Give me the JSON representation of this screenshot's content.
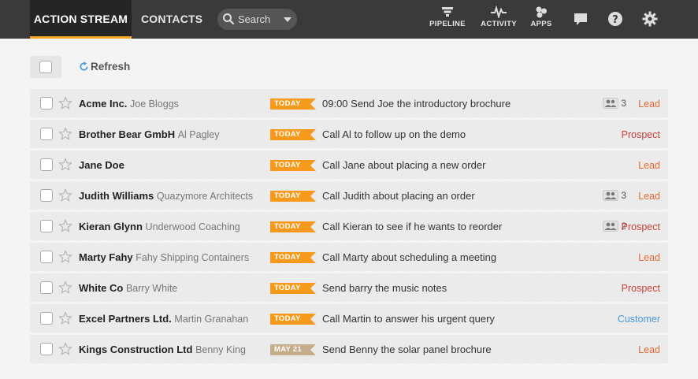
{
  "nav": {
    "tab_action": "ACTION STREAM",
    "tab_contacts": "CONTACTS",
    "search_placeholder": "Search",
    "pipeline": "PIPELINE",
    "activity": "ACTIVITY",
    "apps": "APPS"
  },
  "toolbar": {
    "refresh": "Refresh"
  },
  "colors": {
    "today": "#f79a1c",
    "date": "#c4ad8a",
    "lead": "#e46a32",
    "prospect": "#c9413a",
    "customer": "#4a98d8"
  },
  "rows": [
    {
      "company": "Acme Inc.",
      "person": "Joe Bloggs",
      "badge": "TODAY",
      "task": "09:00 Send Joe the introductory brochure",
      "people": "3",
      "status": "Lead",
      "type": "lead",
      "badge_type": "today"
    },
    {
      "company": "Brother Bear GmbH",
      "person": "Al Pagley",
      "badge": "TODAY",
      "task": "Call Al to follow up on the demo",
      "people": "",
      "status": "Prospect",
      "type": "prospect",
      "badge_type": "today"
    },
    {
      "company": "Jane Doe",
      "person": "",
      "badge": "TODAY",
      "task": "Call Jane about placing a new order",
      "people": "",
      "status": "Lead",
      "type": "lead",
      "badge_type": "today"
    },
    {
      "company": "Judith Williams",
      "person": "Quazymore Architects",
      "badge": "TODAY",
      "task": "Call Judith about placing an order",
      "people": "3",
      "status": "Lead",
      "type": "lead",
      "badge_type": "today"
    },
    {
      "company": "Kieran Glynn",
      "person": "Underwood Coaching",
      "badge": "TODAY",
      "task": "Call Kieran to see if he wants to reorder",
      "people": "2",
      "status": "Prospect",
      "type": "prospect",
      "badge_type": "today"
    },
    {
      "company": "Marty Fahy",
      "person": "Fahy Shipping Containers",
      "badge": "TODAY",
      "task": "Call Marty about scheduling a meeting",
      "people": "",
      "status": "Lead",
      "type": "lead",
      "badge_type": "today"
    },
    {
      "company": "White Co",
      "person": "Barry White",
      "badge": "TODAY",
      "task": "Send barry the music notes",
      "people": "",
      "status": "Prospect",
      "type": "prospect",
      "badge_type": "today"
    },
    {
      "company": "Excel Partners Ltd.",
      "person": "Martin Granahan",
      "badge": "TODAY",
      "task": "Call Martin to answer his urgent query",
      "people": "",
      "status": "Customer",
      "type": "customer",
      "badge_type": "today"
    },
    {
      "company": "Kings Construction Ltd",
      "person": "Benny King",
      "badge": "MAY 21",
      "task": "Send Benny the solar panel brochure",
      "people": "",
      "status": "Lead",
      "type": "lead",
      "badge_type": "date"
    }
  ]
}
